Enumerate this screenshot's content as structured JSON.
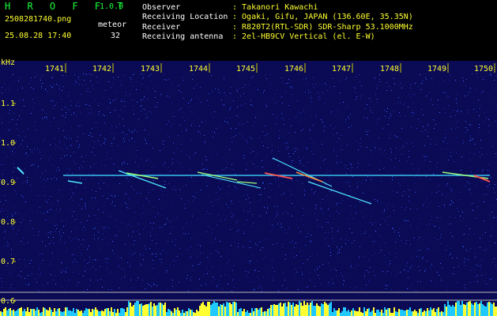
{
  "header": {
    "app_name": "H R O F F T",
    "app_version": "1.0.0",
    "filename": "2508281740.png",
    "meteor_label": "meteor",
    "meteor_count": "32",
    "timestamp": "25.08.28 17:40",
    "info": [
      {
        "key": "Observer",
        "value": ": Takanori Kawachi"
      },
      {
        "key": "Receiving Location",
        "value": ": Ogaki, Gifu, JAPAN (136.60E, 35.35N)"
      },
      {
        "key": "Receiver",
        "value": ": R820T2(RTL-SDR) SDR-Sharp 53.1000MHz"
      },
      {
        "key": "Receiving antenna",
        "value": ": 2el-HB9CV Vertical (el. E-W)"
      }
    ]
  },
  "axes": {
    "y_unit": "kHz",
    "x_ticks": [
      "1741",
      "1742",
      "1743",
      "1744",
      "1745",
      "1746",
      "1747",
      "1748",
      "1749",
      "1750"
    ],
    "y_ticks": [
      "1.1",
      "1.0",
      "0.9",
      "0.8",
      "0.7",
      "0.6"
    ]
  },
  "colors": {
    "text_green": "#19ff3c",
    "text_yellow": "#ffff32",
    "background": "#000000",
    "plot_bg": "#0a0a55"
  }
}
